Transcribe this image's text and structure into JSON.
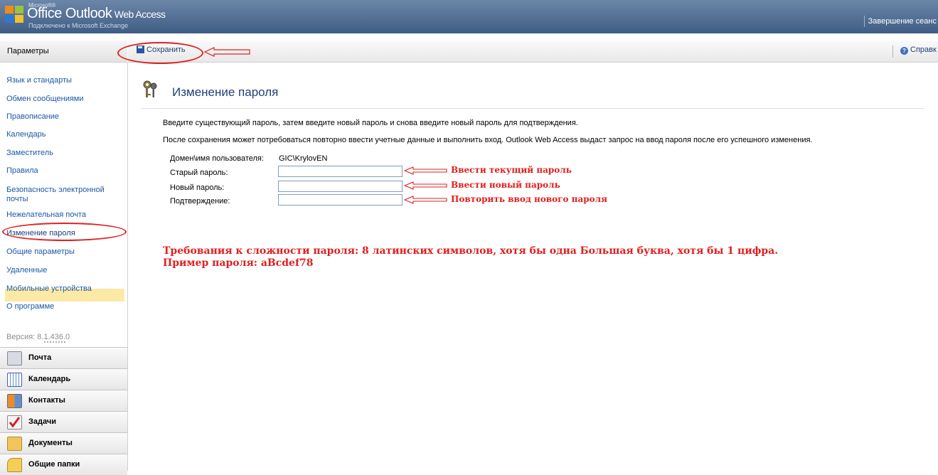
{
  "header": {
    "brand_small": "Microsoft®",
    "brand_name": "Office Outlook",
    "brand_suffix": " Web Access",
    "brand_sub": "Подключено к Microsoft Exchange",
    "logout": "Завершение сеанс"
  },
  "toolbar": {
    "left_title": "Параметры",
    "save_label": "Сохранить",
    "help_label": "Справк"
  },
  "sidebar": {
    "items": [
      "Язык и стандарты",
      "Обмен сообщениями",
      "Правописание",
      "Календарь",
      "Заместитель",
      "Правила",
      "Безопасность электронной почты",
      "Нежелательная почта",
      "Изменение пароля",
      "Общие параметры",
      "Удаленные",
      "Мобильные устройства",
      "О программе"
    ],
    "selected": "Изменение пароля",
    "version": "Версия: 8.1.436.0",
    "modules": [
      "Почта",
      "Календарь",
      "Контакты",
      "Задачи",
      "Документы",
      "Общие папки"
    ]
  },
  "main": {
    "title": "Изменение пароля",
    "intro": "Введите существующий пароль, затем введите новый пароль и снова введите новый пароль для подтверждения.",
    "note": "После сохранения может потребоваться повторно ввести учетные данные и выполнить вход. Outlook Web Access выдаст запрос на ввод пароля после его успешного изменения.",
    "fields": {
      "user_label": "Домен\\имя пользователя:",
      "user_value": "GIC\\KrylovEN",
      "old_label": "Старый пароль:",
      "new_label": "Новый пароль:",
      "confirm_label": "Подтверждение:",
      "old_value": "",
      "new_value": "",
      "confirm_value": ""
    },
    "hints": {
      "old": "Ввести текущий пароль",
      "new": "Ввести новый пароль",
      "confirm": "Повторить ввод нового пароля"
    },
    "requirements_line1": "Требования к сложности пароля: 8 латинских символов, хотя бы одна Большая буква, хотя бы 1 цифра.",
    "requirements_line2": "Пример пароля: aBcdef78"
  },
  "colors": {
    "header": "#3f5d85",
    "link": "#1b57a8",
    "annotation": "#e21e1e",
    "selected_bg": "#fde9a6"
  }
}
